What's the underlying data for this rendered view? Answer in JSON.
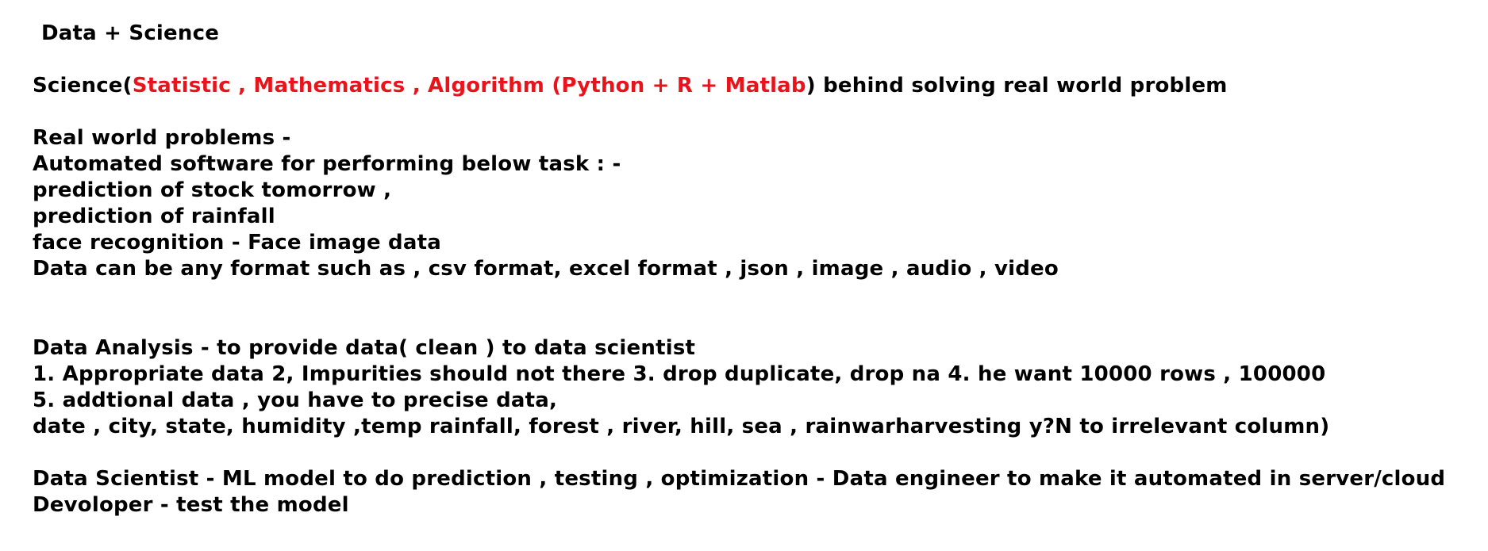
{
  "title": "Data + Science",
  "science_line": {
    "prefix": "Science(",
    "highlight": "Statistic , Mathematics , Algorithm (Python + R + Matlab",
    "suffix": ") behind solving real world problem"
  },
  "real_world": {
    "heading": "Real world problems -",
    "lines": [
      "Automated  software for performing below task : -",
      "prediction of stock tomorrow ,",
      "prediction of rainfall",
      "face recognition - Face image data",
      "Data can be any format such as , csv format, excel format , json , image , audio , video"
    ]
  },
  "data_analysis": {
    "lines": [
      "Data Analysis  - to provide data( clean ) to data scientist",
      "1. Appropriate data 2, Impurities should not there 3. drop duplicate, drop na 4. he want 10000 rows , 100000",
      "5. addtional data , you have to precise data,",
      "date , city, state, humidity ,temp rainfall, forest , river, hill, sea , rainwarharvesting  y?N to irrelevant column)"
    ]
  },
  "roles": {
    "lines": [
      "Data Scientist  - ML model to do prediction , testing , optimization  - Data engineer to make it automated in server/cloud",
      "Devoloper - test the model"
    ]
  },
  "colors": {
    "highlight": "#e8141c",
    "text": "#000000",
    "background": "#ffffff"
  }
}
